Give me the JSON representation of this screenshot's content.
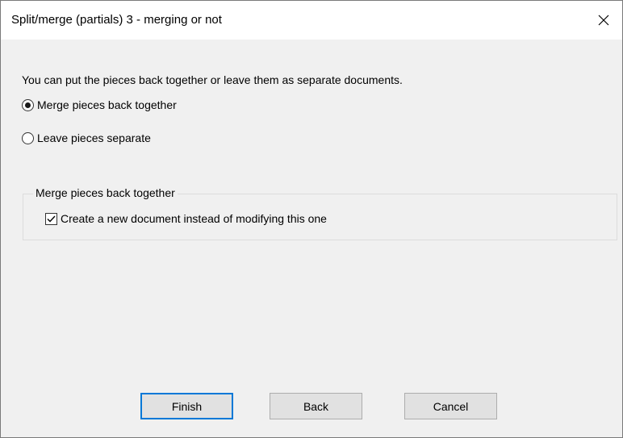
{
  "window": {
    "title": "Split/merge (partials) 3 - merging or not",
    "close_icon": "close-icon"
  },
  "content": {
    "intro": "You can put the pieces back together or leave them as separate documents.",
    "options": [
      {
        "label": "Merge pieces back together",
        "selected": true
      },
      {
        "label": "Leave pieces separate",
        "selected": false
      }
    ],
    "group": {
      "legend": "Merge pieces back together",
      "checkbox_label": "Create a new document instead of modifying this one",
      "checked": true
    }
  },
  "buttons": {
    "finish": "Finish",
    "back": "Back",
    "cancel": "Cancel"
  }
}
